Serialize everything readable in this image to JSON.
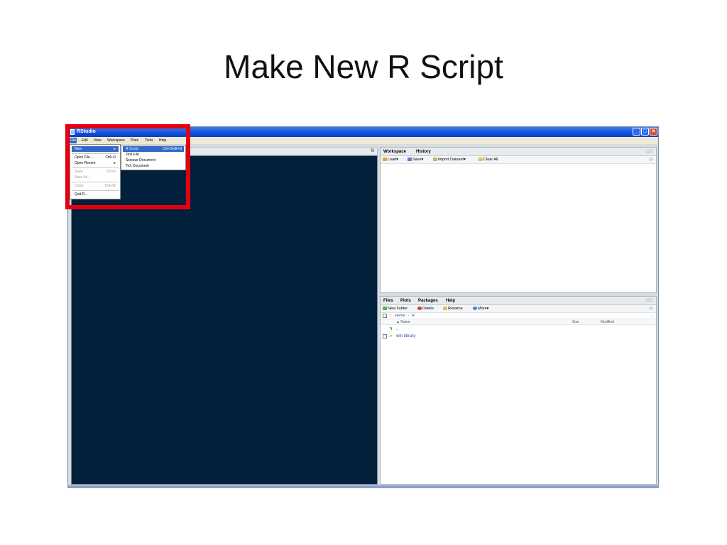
{
  "slide": {
    "title": "Make New R Script"
  },
  "window": {
    "title": "RStudio",
    "buttons": [
      "_",
      "□",
      "✕"
    ]
  },
  "menubar": {
    "items": [
      "File",
      "Edit",
      "View",
      "Workspace",
      "Plots",
      "Tools",
      "Help"
    ]
  },
  "file_menu": {
    "new": "New",
    "open_file": "Open File...",
    "open_file_shortcut": "Ctrl+O",
    "open_recent": "Open Recent",
    "save": "Save",
    "save_shortcut": "Ctrl+S",
    "save_as": "Save As...",
    "close": "Close",
    "close_shortcut": "Ctrl+W",
    "quit": "Quit R...",
    "submenu_arrow": "▸"
  },
  "new_submenu": {
    "r_script": "R Script",
    "r_script_shortcut": "Ctrl+Shift+N",
    "text_file": "Text File",
    "sweave": "Sweave Document",
    "tex": "TeX Document"
  },
  "workspace_pane": {
    "tabs": [
      "Workspace",
      "History"
    ],
    "toolbar": {
      "load": "Load▾",
      "save": "Save▾",
      "import": "Import Dataset▾",
      "clear": "Clear All"
    }
  },
  "files_pane": {
    "tabs": [
      "Files",
      "Plots",
      "Packages",
      "Help"
    ],
    "toolbar": {
      "new_folder": "New Folder",
      "delete": "Delete",
      "rename": "Rename",
      "more": "More▾"
    },
    "path": {
      "home": "Home",
      "sep": "›",
      "dir": "R",
      "more": "..."
    },
    "columns": {
      "name": "▲ Name",
      "size": "Size",
      "modified": "Modified"
    },
    "rows": [
      {
        "name": ".."
      },
      {
        "name": "win-library"
      }
    ]
  },
  "colors": {
    "editor_bg": "#00203c",
    "highlight": "#e3000f",
    "selection": "#316ac5"
  }
}
